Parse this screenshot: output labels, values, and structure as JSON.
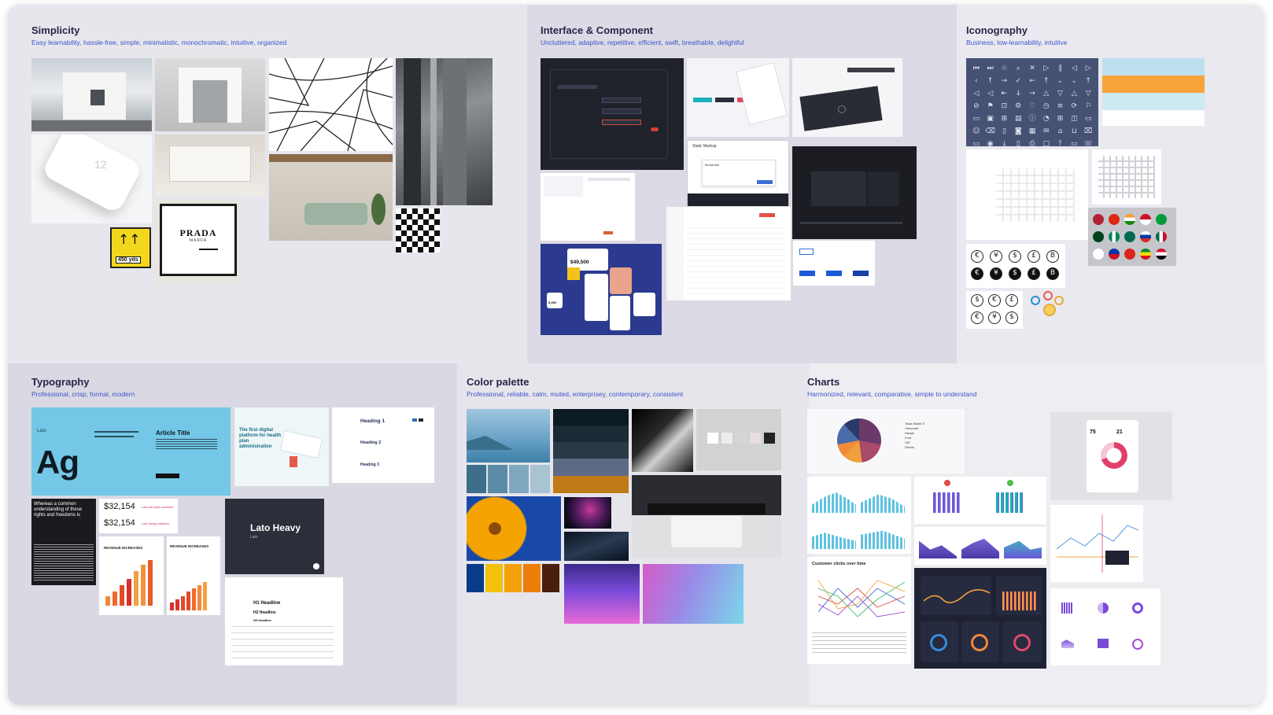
{
  "sections": {
    "simplicity": {
      "title": "Simplicity",
      "subtitle": "Easy learnability, hassle-free, simple, minimalistic, monochromatic, intuitive, organized",
      "prada_brand": "PRADA",
      "prada_sub": "MARFA",
      "sign_text": "450 yds",
      "phone_text": "12"
    },
    "interface": {
      "title": "Interface & Component",
      "subtitle": "Uncluttered, adaptive, repetitive, efficient, swift, breathable, delightful",
      "stat_amount": "$49,500",
      "stat_small": "5,450",
      "modal_title": "Static Markup",
      "modal_inner": "Modal title"
    },
    "iconography": {
      "title": "Iconography",
      "subtitle": "Business, low-learnability, intuitive",
      "currency_symbols": [
        "€",
        "¥",
        "$",
        "£",
        "B"
      ]
    },
    "typography": {
      "title": "Typography",
      "subtitle": "Professional, crisp, formal, modern",
      "font_name": "Lato",
      "specimen": "Ag",
      "article_title": "Article Title",
      "hero_title": "The first digital platform for health plan administration",
      "heading1": "Heading 1",
      "heading2": "Heading 2",
      "heading3": "Heading 3",
      "quote": "Whereas a common understanding of these rights and freedoms is",
      "price1": "$32,154",
      "price2": "$32,154",
      "price1_note": "Lato  old style numbers",
      "price2_note": "Lato  lining numbers",
      "rev1": "REVENUE INCREASES",
      "rev2": "REVENUE INCREASES",
      "lato_heavy": "Lato Heavy",
      "lato_heavy_sub": "Lato",
      "h1_headline": "H1 Headline",
      "h2_headline": "H2 Headline",
      "h3_headline": "H3 Headline"
    },
    "palette": {
      "title": "Color palette",
      "subtitle": "Professional, reliable, calm, muted, enterprisey, contemporary, consistent",
      "swatches_dark": [
        "#0C1A22",
        "#1B2A35",
        "#2A3946",
        "#5B6B86",
        "#C07A18"
      ],
      "swatches_blue": [
        "#3E6E8A",
        "#5A8CA8",
        "#7FA8BE",
        "#A8C4D2"
      ],
      "swatches_warm": [
        "#0A3A8A",
        "#F2C20A",
        "#F5A20A",
        "#EF7D0A",
        "#4A1E0A"
      ],
      "swatches_gray": [
        "#FFFFFF",
        "#EDEDED",
        "#D4D6D8",
        "#E9DDE0",
        "#222222"
      ]
    },
    "charts": {
      "title": "Charts",
      "subtitle": "Harmonized, relevant, comparative, simple to understand",
      "line_chart_title": "Customer clicks over time",
      "activity_value": "75",
      "activity_value2": "21",
      "legend_items": [
        "Tesla Model S",
        "Chevrolet",
        "Nissan",
        "Ford",
        "VW",
        "Others"
      ]
    }
  }
}
